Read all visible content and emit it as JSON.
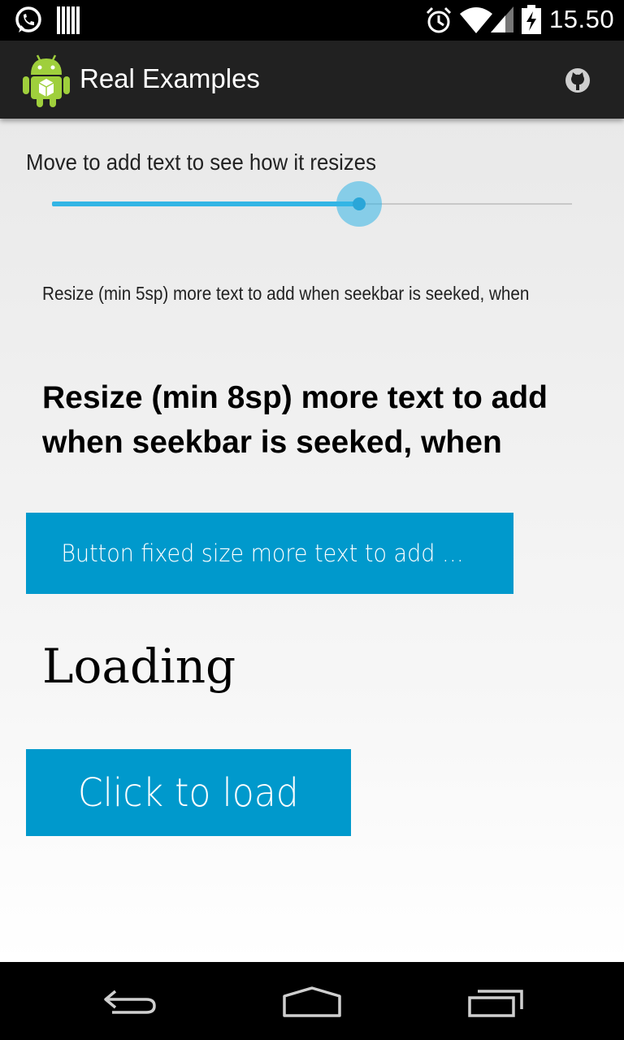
{
  "status_bar": {
    "time": "15.50",
    "icons": [
      "whatsapp-icon",
      "barcode-icon",
      "alarm-icon",
      "wifi-icon",
      "signal-icon",
      "battery-charging-icon"
    ]
  },
  "action_bar": {
    "title": "Real Examples",
    "logo_icon": "android-logo-icon",
    "action_icon": "github-icon"
  },
  "content": {
    "seek_label": "Move to add text to see how it resizes",
    "seekbar_progress": 0.59,
    "small_text": "Resize (min 5sp) more text to add when seekbar is seeked, when",
    "bold_text": "Resize (min 8sp) more text to add when seekbar is seeked, when",
    "fixed_button_label": "Button fixed size more text to add when seekbar is seeked, when",
    "loading_text": "Loading",
    "load_button_label": "Click to load"
  },
  "colors": {
    "accent": "#33b5e5",
    "button": "#0099cc",
    "action_bar": "#212121",
    "system_bar": "#000000"
  },
  "nav_bar": {
    "icons": [
      "back-icon",
      "home-icon",
      "recents-icon"
    ]
  }
}
